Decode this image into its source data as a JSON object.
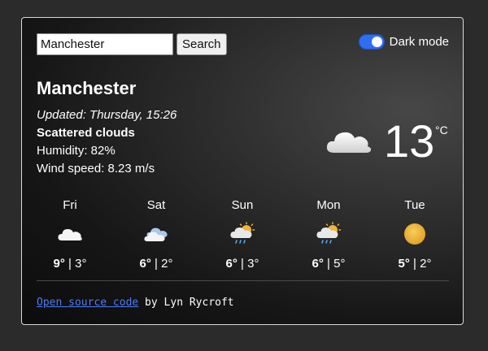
{
  "search": {
    "value": "Manchester",
    "button_label": "Search"
  },
  "toggle": {
    "label": "Dark mode",
    "checked": true
  },
  "current": {
    "city": "Manchester",
    "updated": "Updated: Thursday, 15:26",
    "condition": "Scattered clouds",
    "humidity": "Humidity: 82%",
    "wind": "Wind speed: 8.23 m/s",
    "temp": "13",
    "unit": "°C",
    "icon": "cloud-icon"
  },
  "forecast": [
    {
      "day": "Fri",
      "high": "9°",
      "sep": " | ",
      "low": "3°",
      "icon": "cloud-icon"
    },
    {
      "day": "Sat",
      "high": "6°",
      "sep": " | ",
      "low": "2°",
      "icon": "cloud-icon"
    },
    {
      "day": "Sun",
      "high": "6°",
      "sep": " | ",
      "low": "3°",
      "icon": "sun-cloud-rain-icon"
    },
    {
      "day": "Mon",
      "high": "6°",
      "sep": " | ",
      "low": "5°",
      "icon": "sun-cloud-rain-icon"
    },
    {
      "day": "Tue",
      "high": "5°",
      "sep": " | ",
      "low": "2°",
      "icon": "sun-icon"
    }
  ],
  "footer": {
    "link_text": "Open source code",
    "author_text": " by Lyn Rycroft"
  },
  "colors": {
    "accent": "#2f6df5",
    "link": "#4d7cf5",
    "sun": "#f2b33a"
  }
}
